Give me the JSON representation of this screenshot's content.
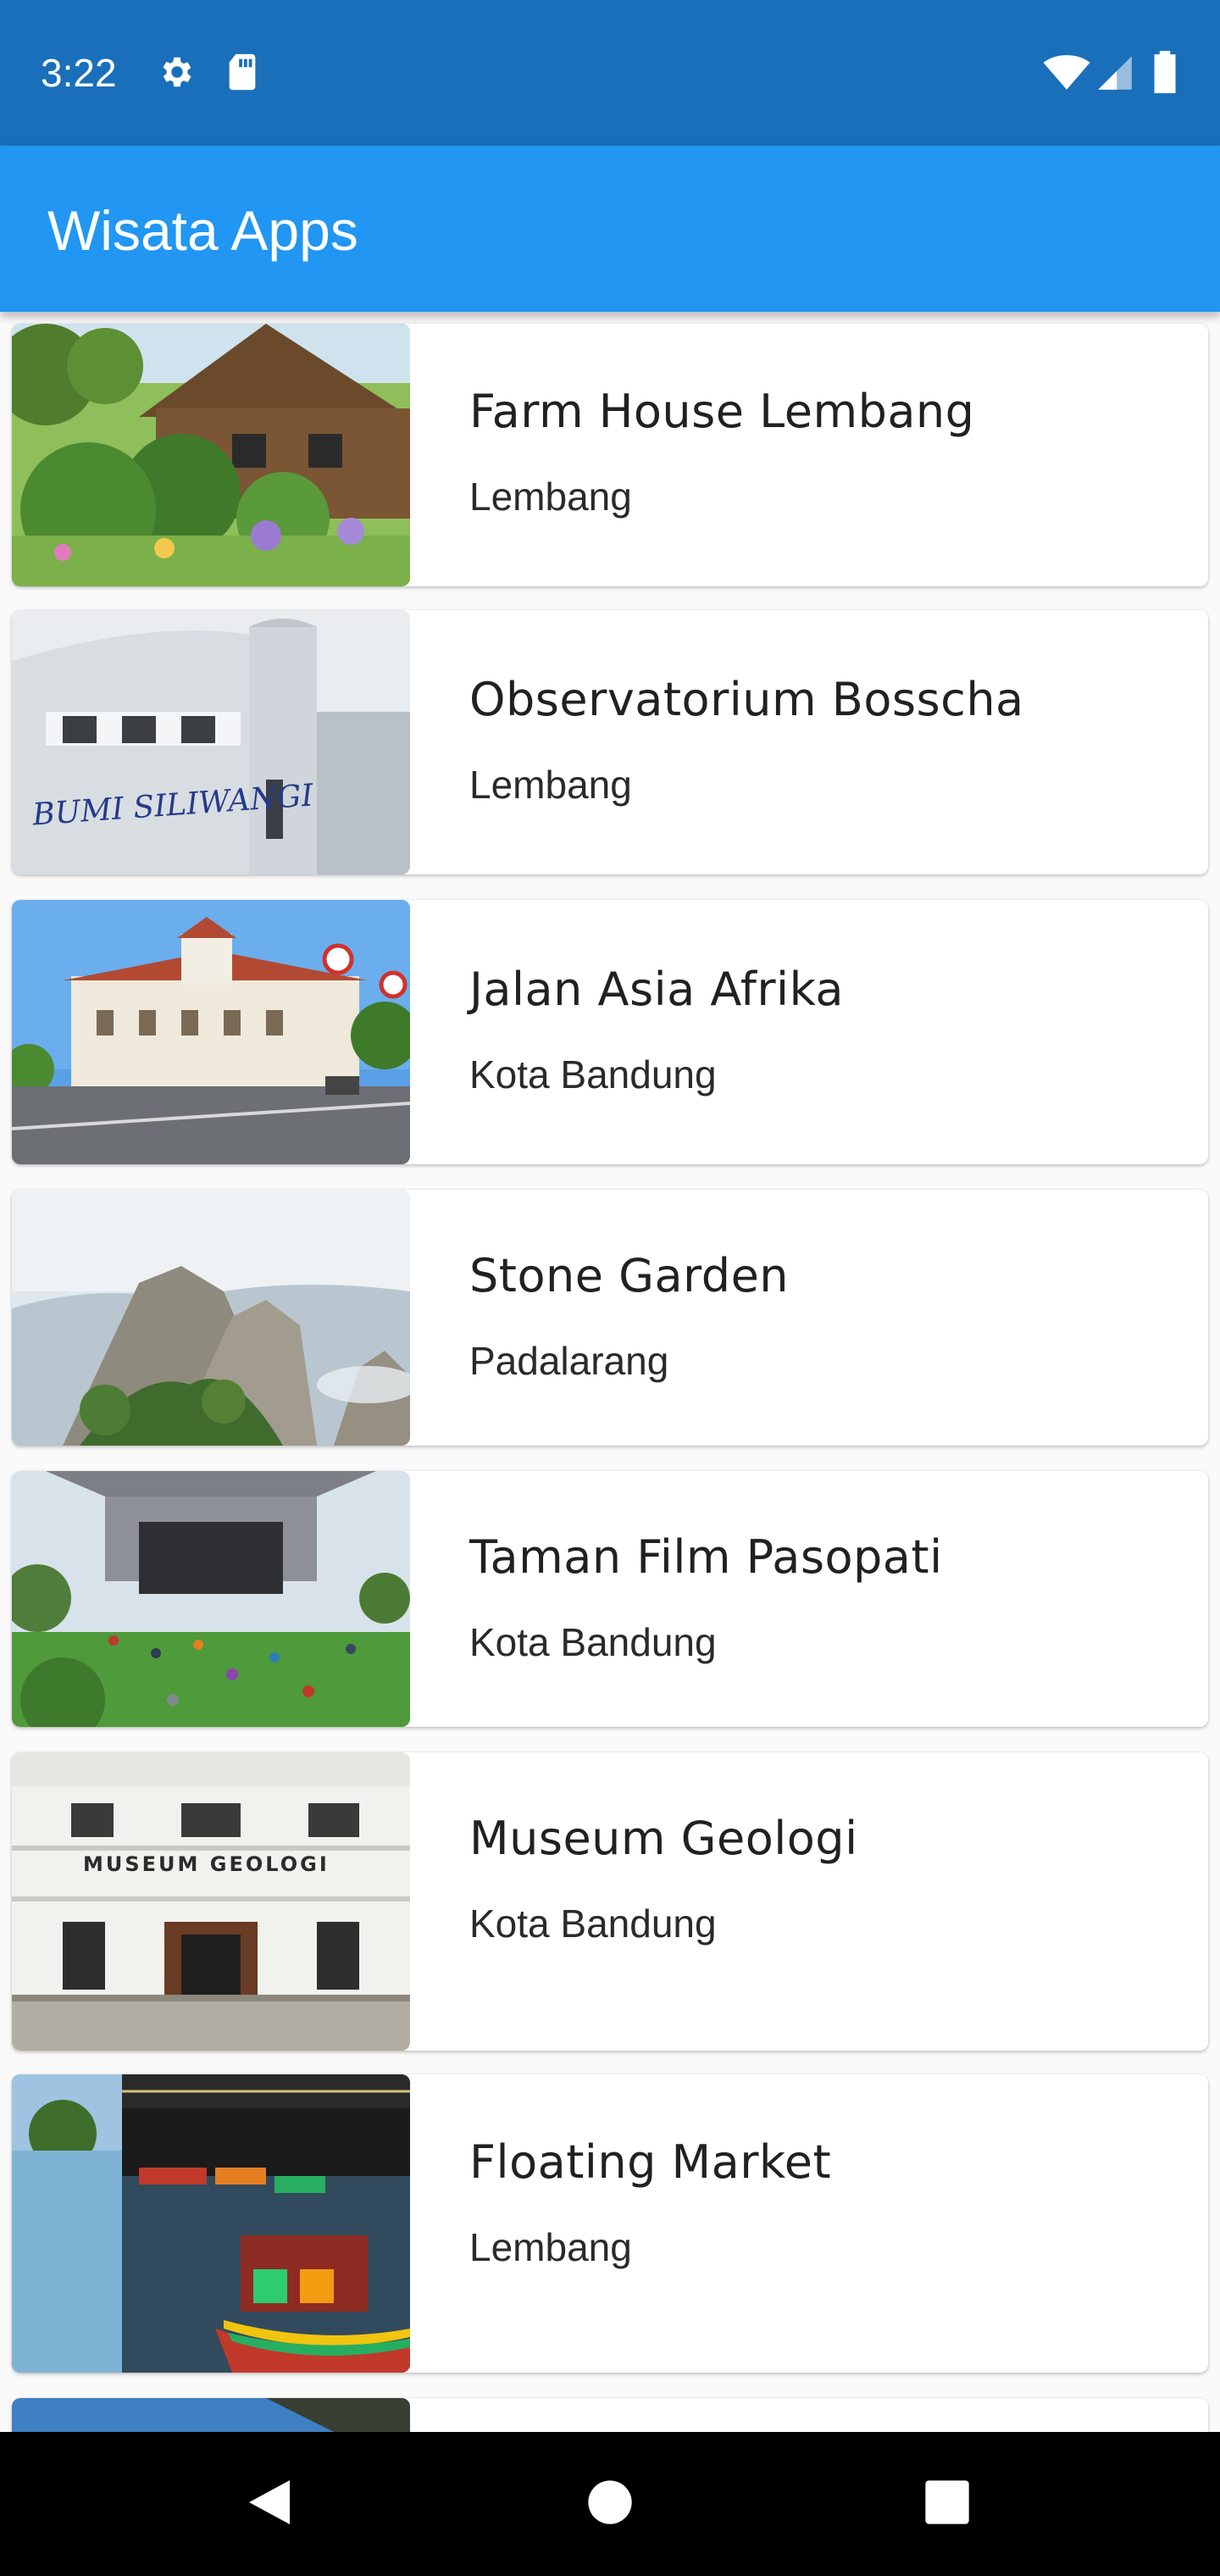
{
  "status_bar": {
    "time": "3:22",
    "left_icons": [
      "gear-icon",
      "sd-card-icon"
    ],
    "right_icons": [
      "wifi-icon",
      "cellular-signal-icon",
      "battery-icon"
    ]
  },
  "app_bar": {
    "title": "Wisata Apps",
    "color": "#2196f3"
  },
  "places": [
    {
      "name": "Farm House Lembang",
      "location": "Lembang"
    },
    {
      "name": "Observatorium Bosscha",
      "location": "Lembang",
      "image_text": "BUMI SILIWANGI"
    },
    {
      "name": "Jalan Asia Afrika",
      "location": "Kota Bandung"
    },
    {
      "name": "Stone Garden",
      "location": "Padalarang"
    },
    {
      "name": "Taman Film Pasopati",
      "location": "Kota Bandung"
    },
    {
      "name": "Museum Geologi",
      "location": "Kota Bandung",
      "image_text": "MUSEUM GEOLOGI"
    },
    {
      "name": "Floating Market",
      "location": "Lembang"
    }
  ],
  "nav_bar": {
    "buttons": [
      "back-icon",
      "home-icon",
      "recents-icon"
    ]
  }
}
